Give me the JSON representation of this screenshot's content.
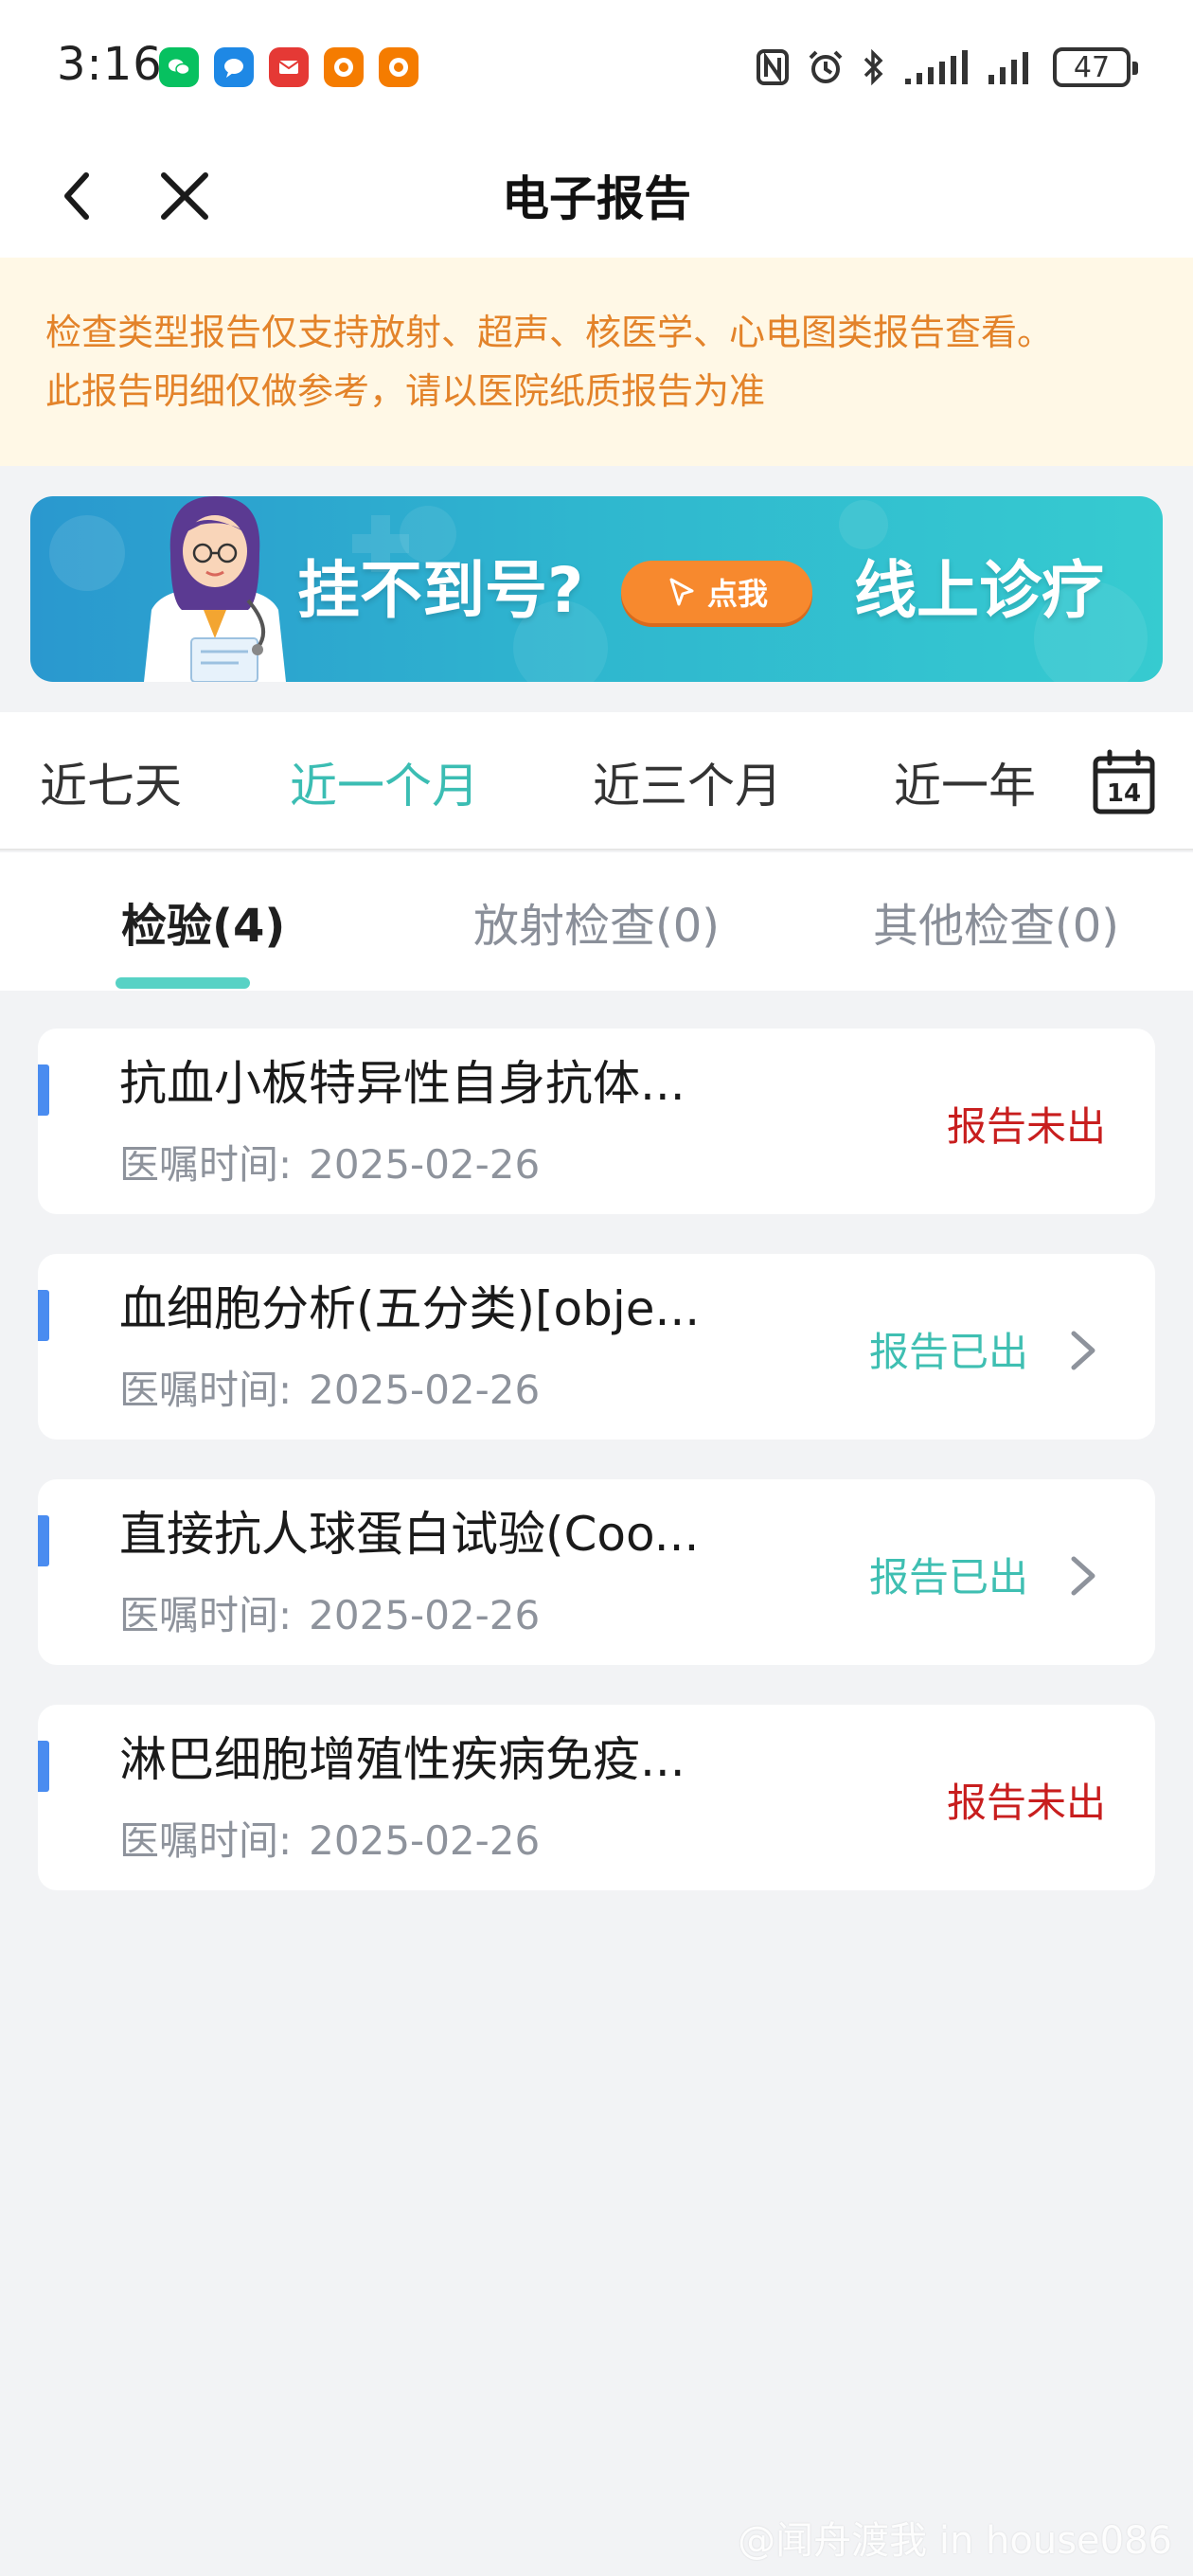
{
  "status_bar": {
    "time": "3:16",
    "battery": "47",
    "app_icons": [
      {
        "name": "wechat-icon",
        "color": "#07c160"
      },
      {
        "name": "message-icon",
        "color": "#1e88e5"
      },
      {
        "name": "mail-icon",
        "color": "#e53935"
      },
      {
        "name": "taobao-icon",
        "color": "#f57c00"
      },
      {
        "name": "taobao-icon",
        "color": "#f57c00"
      }
    ]
  },
  "nav": {
    "title": "电子报告",
    "back_icon": "back-arrow-icon",
    "close_icon": "close-icon"
  },
  "notice": {
    "line1": "检查类型报告仅支持放射、超声、核医学、心电图类报告查看。",
    "line2": "此报告明细仅做参考，请以医院纸质报告为准"
  },
  "banner": {
    "text1": "挂不到号?",
    "button_label": "点我",
    "text2": "线上诊疗"
  },
  "time_ranges": {
    "items": [
      "近七天",
      "近一个月",
      "近三个月",
      "近一年"
    ],
    "active_index": 1,
    "calendar_day": "14"
  },
  "categories": {
    "items": [
      "检验(4)",
      "放射检查(0)",
      "其他检查(0)"
    ],
    "active_index": 0
  },
  "reports": [
    {
      "title": "抗血小板特异性自身抗体...",
      "time_label": "医嘱时间:",
      "time": "2025-02-26",
      "status": "报告未出",
      "status_type": "pending"
    },
    {
      "title": "血细胞分析(五分类)[obje...",
      "time_label": "医嘱时间:",
      "time": "2025-02-26",
      "status": "报告已出",
      "status_type": "done"
    },
    {
      "title": "直接抗人球蛋白试验(Coo...",
      "time_label": "医嘱时间:",
      "time": "2025-02-26",
      "status": "报告已出",
      "status_type": "done"
    },
    {
      "title": "淋巴细胞增殖性疾病免疫...",
      "time_label": "医嘱时间:",
      "time": "2025-02-26",
      "status": "报告未出",
      "status_type": "pending"
    }
  ],
  "colors": {
    "accent": "#3bbdb3",
    "pending": "#c81e1e",
    "notice_text": "#e3832a",
    "notice_bg": "#fff8e6",
    "marker": "#4a8cf0"
  },
  "watermark": "@闻舟渡我 in house086"
}
